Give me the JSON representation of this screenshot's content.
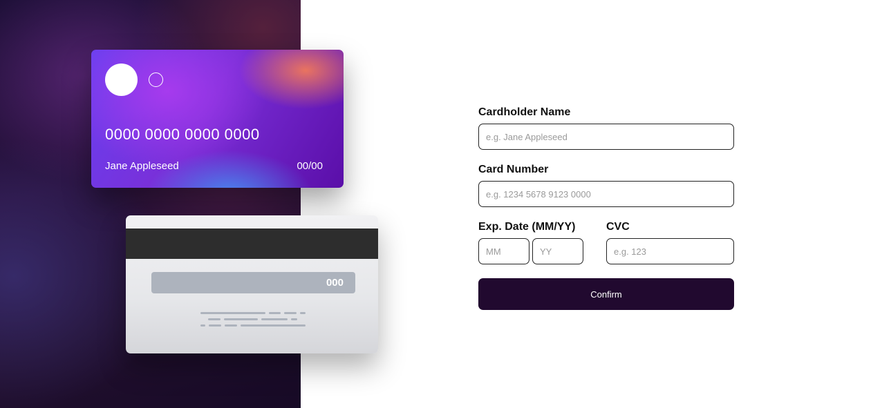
{
  "card_front": {
    "number": "0000 0000 0000 0000",
    "name": "Jane Appleseed",
    "expiry": "00/00"
  },
  "card_back": {
    "cvc": "000"
  },
  "form": {
    "name_label": "Cardholder Name",
    "name_placeholder": "e.g. Jane Appleseed",
    "number_label": "Card Number",
    "number_placeholder": "e.g. 1234 5678 9123 0000",
    "exp_label": "Exp. Date (MM/YY)",
    "month_placeholder": "MM",
    "year_placeholder": "YY",
    "cvc_label": "CVC",
    "cvc_placeholder": "e.g. 123",
    "confirm_label": "Confirm"
  },
  "colors": {
    "button": "#21092f",
    "card_gradient_start": "#6840f0",
    "card_gradient_end": "#5a0ea8"
  }
}
